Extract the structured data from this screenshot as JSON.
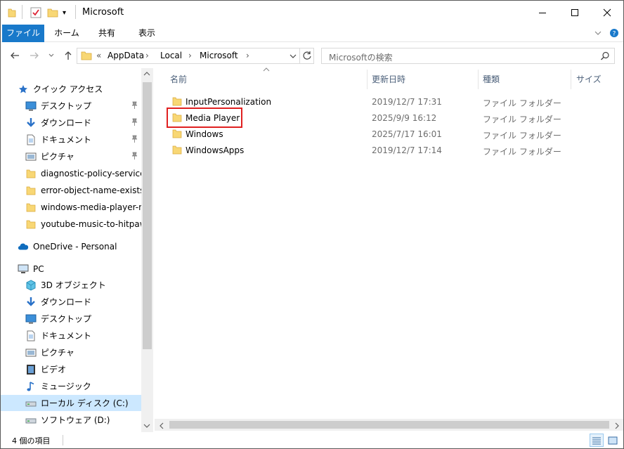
{
  "window": {
    "title": "Microsoft"
  },
  "ribbon": {
    "tabs": [
      "ファイル",
      "ホーム",
      "共有",
      "表示"
    ]
  },
  "address": {
    "overflow": "«",
    "crumbs": [
      "AppData",
      "Local",
      "Microsoft"
    ]
  },
  "search": {
    "placeholder": "Microsoftの検索"
  },
  "nav": {
    "quick_access": "クイック アクセス",
    "quick_items": [
      {
        "label": "デスクトップ",
        "icon": "desktop-icon",
        "pinned": true
      },
      {
        "label": "ダウンロード",
        "icon": "download-icon",
        "pinned": true
      },
      {
        "label": "ドキュメント",
        "icon": "document-icon",
        "pinned": true
      },
      {
        "label": "ピクチャ",
        "icon": "pictures-icon",
        "pinned": true
      },
      {
        "label": "diagnostic-policy-service",
        "icon": "folder-icon",
        "pinned": false
      },
      {
        "label": "error-object-name-exists",
        "icon": "folder-icon",
        "pinned": false
      },
      {
        "label": "windows-media-player-n",
        "icon": "folder-icon",
        "pinned": false
      },
      {
        "label": "youtube-music-to-hitpaw",
        "icon": "folder-icon",
        "pinned": false
      }
    ],
    "onedrive": "OneDrive - Personal",
    "pc": "PC",
    "pc_items": [
      {
        "label": "3D オブジェクト",
        "icon": "3d-objects-icon"
      },
      {
        "label": "ダウンロード",
        "icon": "download-icon"
      },
      {
        "label": "デスクトップ",
        "icon": "desktop-icon"
      },
      {
        "label": "ドキュメント",
        "icon": "document-icon"
      },
      {
        "label": "ピクチャ",
        "icon": "pictures-icon"
      },
      {
        "label": "ビデオ",
        "icon": "video-icon"
      },
      {
        "label": "ミュージック",
        "icon": "music-icon"
      },
      {
        "label": "ローカル ディスク (C:)",
        "icon": "drive-icon",
        "selected": true
      },
      {
        "label": "ソフトウェア (D:)",
        "icon": "drive-icon"
      }
    ]
  },
  "columns": {
    "name": "名前",
    "modified": "更新日時",
    "type": "種類",
    "size": "サイズ"
  },
  "files": [
    {
      "name": "InputPersonalization",
      "modified": "2019/12/7 17:31",
      "type": "ファイル フォルダー"
    },
    {
      "name": "Media Player",
      "modified": "2025/9/9 16:12",
      "type": "ファイル フォルダー",
      "highlighted": true
    },
    {
      "name": "Windows",
      "modified": "2025/7/17 16:01",
      "type": "ファイル フォルダー"
    },
    {
      "name": "WindowsApps",
      "modified": "2019/12/7 17:14",
      "type": "ファイル フォルダー"
    }
  ],
  "status": {
    "count": "4 個の項目"
  },
  "colors": {
    "accent": "#1979ca",
    "folder": "#f8d775",
    "highlight": "#e02020",
    "selection": "#cce8ff"
  }
}
